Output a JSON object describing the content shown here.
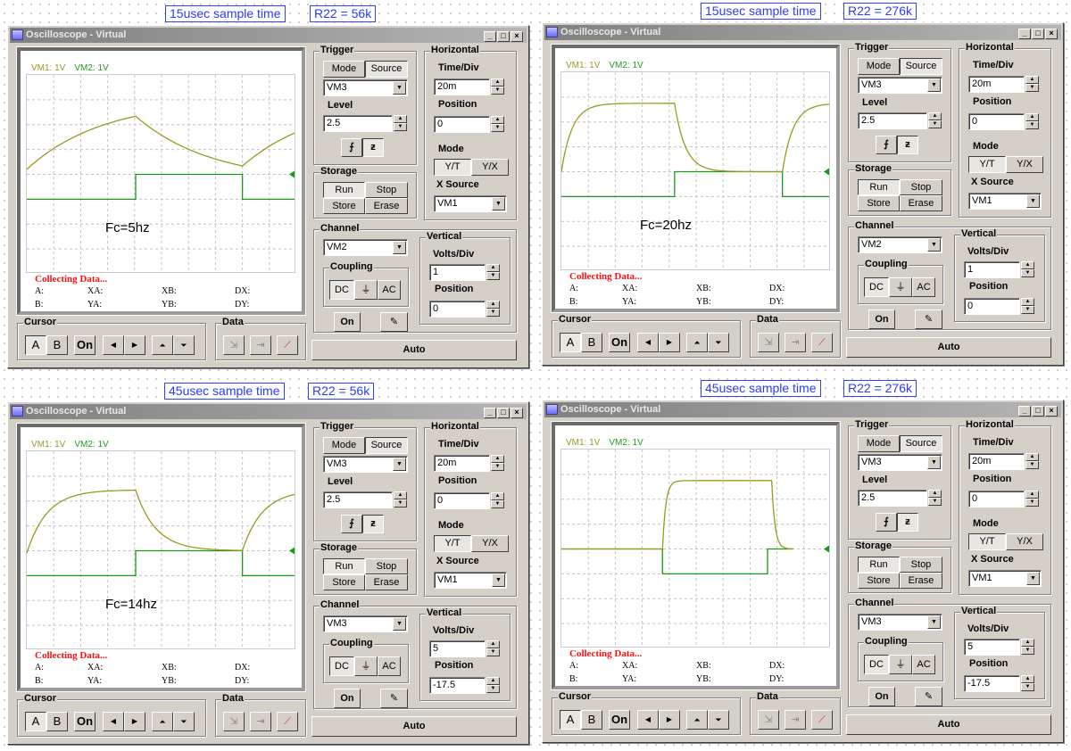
{
  "ui": {
    "window_title": "Oscilloscope - Virtual",
    "min": "_",
    "max": "□",
    "close": "×",
    "legend_vm1": "VM1: 1V",
    "legend_vm2": "VM2: 1V",
    "collecting": "Collecting Data...",
    "ro_a": "A:",
    "ro_b": "B:",
    "ro_xa": "XA:",
    "ro_ya": "YA:",
    "ro_xb": "XB:",
    "ro_yb": "YB:",
    "ro_dx": "DX:",
    "ro_dy": "DY:",
    "trigger": "Trigger",
    "mode": "Mode",
    "source": "Source",
    "level": "Level",
    "edge_rise": "⨍",
    "edge_fall": "ƶ",
    "horizontal": "Horizontal",
    "time_div": "Time/Div",
    "position": "Position",
    "hmode": "Mode",
    "yt": "Y/T",
    "yx": "Y/X",
    "x_source": "X Source",
    "storage": "Storage",
    "run": "Run",
    "stop": "Stop",
    "store": "Store",
    "erase": "Erase",
    "channel": "Channel",
    "coupling": "Coupling",
    "dc": "DC",
    "gnd": "⏚",
    "ac": "AC",
    "on": "On",
    "vertical": "Vertical",
    "volts_div": "Volts/Div",
    "cursor": "Cursor",
    "a": "A",
    "b": "B",
    "left": "◀",
    "right": "▶",
    "up": "⏶",
    "down": "⏷",
    "data": "Data",
    "auto": "Auto",
    "colors": {
      "vm1": "#9a9a20",
      "vm2": "#1a9a1a",
      "label": "#2a3cff",
      "collecting": "#ff1010"
    }
  },
  "panels": [
    {
      "sample_label": "15usec sample time",
      "r_label": "R22 = 56k",
      "annotation": "Fc=5hz",
      "trigger_source": "VM3",
      "level": "2.5",
      "time_div": "20m",
      "h_position": "0",
      "x_source": "VM1",
      "channel": "VM2",
      "volts_div": "1",
      "v_position": "0",
      "traces": {
        "vm2": [
          [
            0,
            -1
          ],
          [
            4.04,
            -1
          ],
          [
            4.04,
            0
          ],
          [
            8,
            0
          ],
          [
            8,
            -1
          ],
          [
            10,
            -1
          ]
        ],
        "vm1": {
          "v0": 0.2,
          "tau": 2.8,
          "segments": [
            [
              0,
              4.04,
              3.0
            ],
            [
              4.04,
              8,
              -0.3
            ],
            [
              8,
              10,
              3.0
            ]
          ]
        }
      }
    },
    {
      "sample_label": "15usec sample time",
      "r_label": "R22 = 276k",
      "annotation": "Fc=20hz",
      "trigger_source": "VM3",
      "level": "2.5",
      "time_div": "20m",
      "h_position": "0",
      "x_source": "VM1",
      "channel": "VM2",
      "volts_div": "1",
      "v_position": "0",
      "traces": {
        "vm2": [
          [
            0,
            -1
          ],
          [
            4.2,
            -1
          ],
          [
            4.2,
            0
          ],
          [
            8.2,
            0
          ],
          [
            8.2,
            -1
          ],
          [
            10,
            -1
          ]
        ],
        "vm1": {
          "v0": 0,
          "tau": 0.4,
          "segments": [
            [
              0,
              4.2,
              2.75
            ],
            [
              4.2,
              8.2,
              0
            ],
            [
              8.2,
              10,
              2.75
            ]
          ]
        }
      }
    },
    {
      "sample_label": "45usec sample time",
      "r_label": "R22 = 56k",
      "annotation": "Fc=14hz",
      "trigger_source": "VM3",
      "level": "2.5",
      "time_div": "20m",
      "h_position": "0",
      "x_source": "VM1",
      "channel": "VM3",
      "volts_div": "5",
      "v_position": "-17.5",
      "traces": {
        "vm2": [
          [
            0,
            -1
          ],
          [
            4.04,
            -1
          ],
          [
            4.04,
            0
          ],
          [
            8,
            0
          ],
          [
            8,
            -1
          ],
          [
            10,
            -1
          ]
        ],
        "vm1": {
          "v0": -0.1,
          "tau": 0.75,
          "segments": [
            [
              0,
              4.04,
              2.45
            ],
            [
              4.04,
              8,
              0
            ],
            [
              8,
              10,
              2.45
            ]
          ]
        }
      }
    },
    {
      "sample_label": "45usec sample time",
      "r_label": "R22 = 276k",
      "annotation": "",
      "trigger_source": "VM3",
      "level": "2.5",
      "time_div": "20m",
      "h_position": "0",
      "x_source": "VM1",
      "channel": "VM3",
      "volts_div": "5",
      "v_position": "-17.5",
      "traces": {
        "vm2": [
          [
            0,
            0
          ],
          [
            3.75,
            0
          ],
          [
            3.75,
            -1
          ],
          [
            7.65,
            -1
          ],
          [
            7.65,
            0
          ],
          [
            8.6,
            0
          ]
        ],
        "vm1": {
          "v0": 0,
          "tau": 0.12,
          "segments": [
            [
              0,
              3.75,
              0
            ],
            [
              3.75,
              7.8,
              2.75
            ],
            [
              7.8,
              8.6,
              0
            ]
          ]
        }
      }
    }
  ]
}
